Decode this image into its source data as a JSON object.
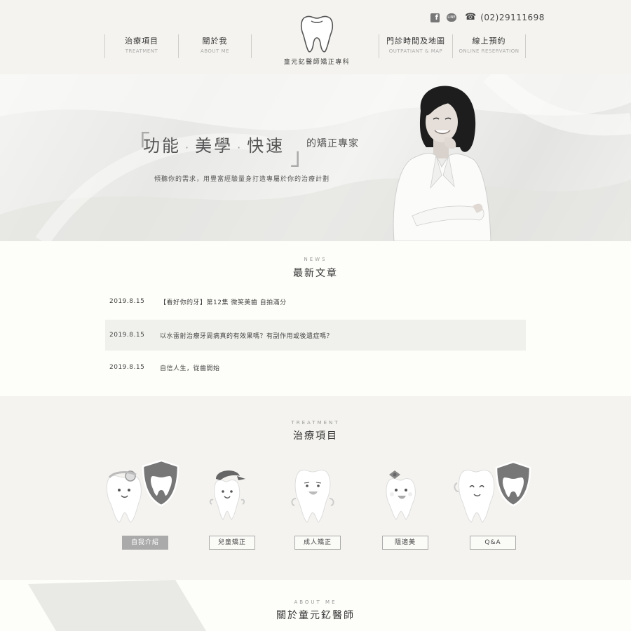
{
  "header": {
    "facebook_icon": "f",
    "line_icon": "LINE",
    "phone_icon": "☎",
    "phone": "(02)29111698",
    "logo_text": "童元釔醫師矯正專科",
    "nav_left": [
      {
        "zh": "治療項目",
        "en": "TREATMENT"
      },
      {
        "zh": "關於我",
        "en": "ABOUT ME"
      }
    ],
    "nav_right": [
      {
        "zh": "門診時間及地圖",
        "en": "OUTPATIANT & MAP"
      },
      {
        "zh": "線上預約",
        "en": "ONLINE RESERVATION"
      }
    ]
  },
  "hero": {
    "bracket_open": "「",
    "bracket_close": "」",
    "words": [
      "功能",
      "美學",
      "快速"
    ],
    "separator": "·",
    "suffix": "的矯正專家",
    "subtitle": "傾聽你的需求，用豐富經驗量身打造專屬於你的治療計劃"
  },
  "news": {
    "label_en": "NEWS",
    "title": "最新文章",
    "items": [
      {
        "date": "2019.8.15",
        "title": "【看好你的牙】第12集 微笑美齒 自拍滿分"
      },
      {
        "date": "2019.8.15",
        "title": "以水雷射治療牙周病真的有效果嗎？有副作用或後遺症嗎？"
      },
      {
        "date": "2019.8.15",
        "title": "自信人生，從齒開始"
      }
    ]
  },
  "treatment": {
    "label_en": "TREATMENT",
    "title": "治療項目",
    "items": [
      {
        "label": "自我介紹",
        "active": true
      },
      {
        "label": "兒童矯正",
        "active": false
      },
      {
        "label": "成人矯正",
        "active": false
      },
      {
        "label": "隱適美",
        "active": false
      },
      {
        "label": "Q&A",
        "active": false
      }
    ]
  },
  "about": {
    "label_en": "ABOUT ME",
    "title": "關於童元釔醫師"
  },
  "colors": {
    "header_bg": "#f4f3ef",
    "page_bg": "#fdfdf9",
    "active_button": "#aaaaaa",
    "shield": "#777777"
  }
}
